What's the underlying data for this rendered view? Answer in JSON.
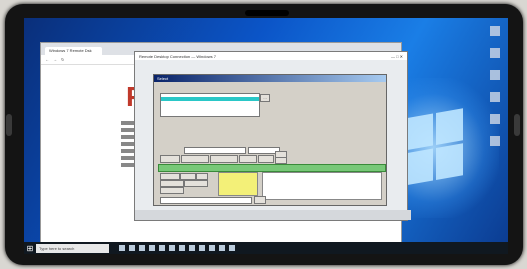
{
  "browser": {
    "tab_label": "Windows 7 Remote Dsk",
    "url": "",
    "logo_text": "P"
  },
  "remote": {
    "title": "Remote Desktop Connection — Windows 7",
    "taskbar_left": "",
    "taskbar_right": ""
  },
  "app": {
    "title": "Select",
    "path_label": "",
    "path_value": "",
    "note_line1": "",
    "note_line2": "",
    "filter_label": "",
    "buttons": [
      "",
      "",
      "",
      "",
      "",
      "",
      ""
    ],
    "green_bar": "",
    "lower_buttons": [
      "",
      "",
      "",
      "",
      "",
      ""
    ]
  },
  "taskbar": {
    "search_placeholder": "Type here to search",
    "time": "",
    "date": ""
  },
  "colors": {
    "accent": "#2ac7c7",
    "green": "#78c878",
    "yellow": "#f3f078",
    "desktop": "#0b55c8"
  }
}
